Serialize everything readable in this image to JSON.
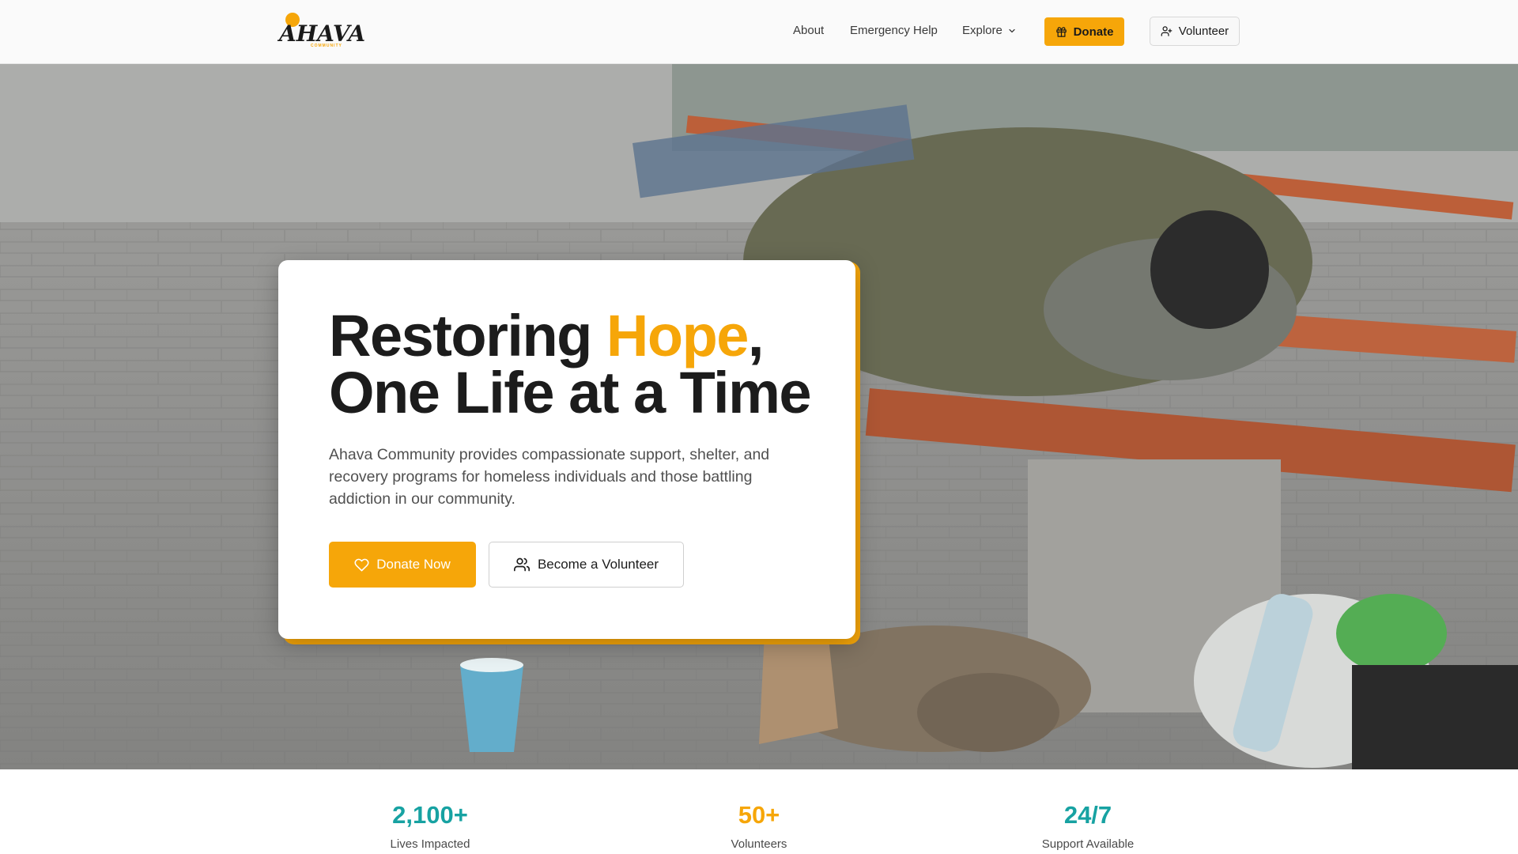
{
  "brand": {
    "name": "AHAVA",
    "tagline": "COMMUNITY"
  },
  "nav": {
    "about": "About",
    "emergency": "Emergency Help",
    "explore": "Explore",
    "donate": "Donate",
    "volunteer": "Volunteer"
  },
  "hero": {
    "title_part1": "Restoring ",
    "title_accent": "Hope",
    "title_part2": ",",
    "title_line2": "One Life at a Time",
    "description": "Ahava Community provides compassionate support, shelter, and recovery programs for homeless individuals and those battling addiction in our community.",
    "primary_cta": "Donate Now",
    "secondary_cta": "Become a Volunteer"
  },
  "stats": [
    {
      "value": "2,100+",
      "label": "Lives Impacted",
      "color": "#17a2a2"
    },
    {
      "value": "50+",
      "label": "Volunteers",
      "color": "#f6a609"
    },
    {
      "value": "24/7",
      "label": "Support Available",
      "color": "#17a2a2"
    }
  ],
  "colors": {
    "accent": "#f6a609",
    "teal": "#17a2a2",
    "text": "#1c1c1c"
  },
  "icons": {
    "donate_top": "gift-icon",
    "volunteer_top": "user-plus-icon",
    "explore": "chevron-down-icon",
    "donate_now": "heart-icon",
    "become_volunteer": "users-icon"
  }
}
